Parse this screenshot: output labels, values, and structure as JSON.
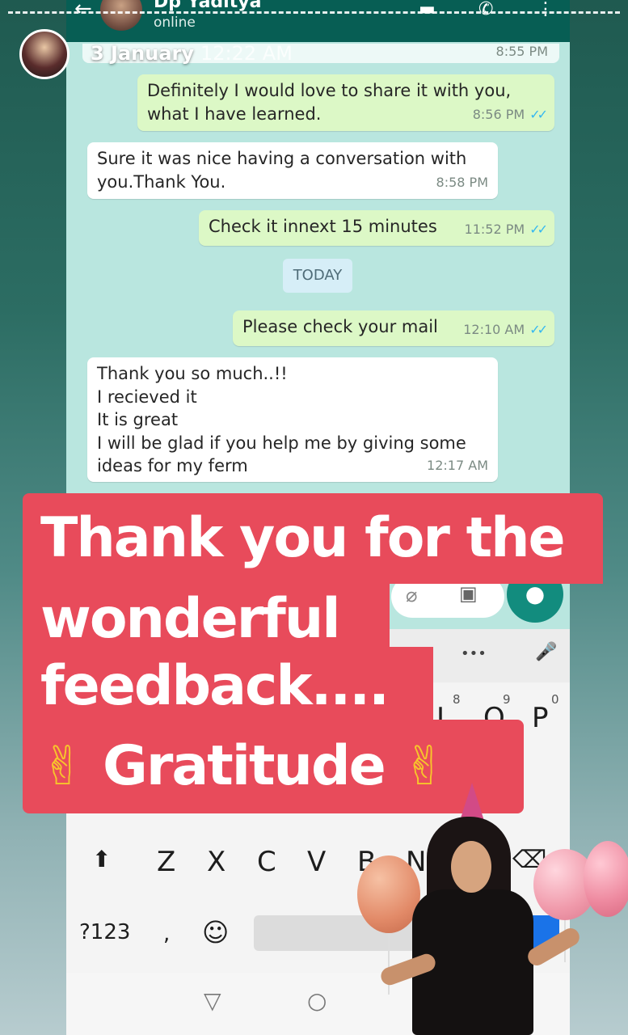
{
  "chat": {
    "contact_name": "Dp Yaditya",
    "contact_status": "online",
    "icons": {
      "back": "arrow-left-icon",
      "video": "video-call-icon",
      "call": "phone-icon",
      "menu": "more-vert-icon"
    },
    "messages": [
      {
        "direction": "in",
        "text": "",
        "time": "8:55 PM"
      },
      {
        "direction": "out",
        "text": "Definitely I would love to share it with you,\nwhat I have learned.",
        "time": "8:56 PM",
        "ticks": "✓✓"
      },
      {
        "direction": "in",
        "text": "Sure it was nice having a conversation with\nyou.Thank You.",
        "time": "8:58 PM"
      },
      {
        "direction": "out",
        "text": "Check it innext 15 minutes",
        "time": "11:52 PM",
        "ticks": "✓✓"
      },
      {
        "direction": "out",
        "text": "Please check your mail",
        "time": "12:10 AM",
        "ticks": "✓✓"
      },
      {
        "direction": "in",
        "text": "Thank you so much..!!\n I recieved it\nIt is great\nI will be glad if you help me by giving some\nideas for my ferm",
        "time": "12:17 AM"
      }
    ],
    "day_separator": "TODAY"
  },
  "story": {
    "date": "3 January",
    "time": "12:22 AM",
    "banner_lines": [
      "Thank you for the",
      "wonderful",
      "feedback....",
      "Gratitude"
    ],
    "emoji": "✌"
  },
  "keyboard": {
    "top_row_hints": [
      "8",
      "9",
      "0"
    ],
    "top_row_keys": [
      "I",
      "O",
      "P"
    ],
    "bottom_row_keys": [
      "Z",
      "X",
      "C",
      "V",
      "B",
      "N"
    ],
    "symbols_key": "?123",
    "comma_key": ",",
    "emoji_key": "☺",
    "shift_key": "⬆",
    "backspace_key": "⌫",
    "toolbar_more": "•••",
    "toolbar_mic": "🎤",
    "enter_key": "↵"
  },
  "navbar": {
    "back": "▽",
    "home": "○"
  },
  "colors": {
    "banner": "#e84b5b",
    "wa_header": "#075e54",
    "out_bubble": "#dcf8c6",
    "chat_bg": "#b9e6df"
  }
}
